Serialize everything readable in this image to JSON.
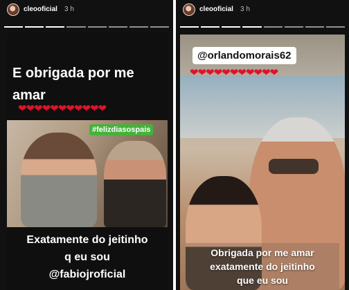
{
  "left_story": {
    "username": "cleooficial",
    "time": "3 h",
    "title_line1": "E obrigada por me",
    "title_line2": "amar",
    "hearts": "❤❤❤❤❤❤❤❤❤❤❤",
    "hashtag": "#felizdiasospais",
    "bottom_line1": "Exatamente do jeitinho",
    "bottom_line2": "q eu sou",
    "bottom_mention": "@fabiojroficial"
  },
  "right_story": {
    "username": "cleooficial",
    "time": "3 h",
    "mention": "@orlandomorais62",
    "hearts": "❤❤❤❤❤❤❤❤❤❤❤",
    "caption_line1": "Obrigada por me amar",
    "caption_line2": "exatamente do jeitinho",
    "caption_line3": "que eu sou"
  },
  "colors": {
    "heart": "#e0112b",
    "hashtag_bg": "#44b33a",
    "story_bg": "#111111"
  }
}
